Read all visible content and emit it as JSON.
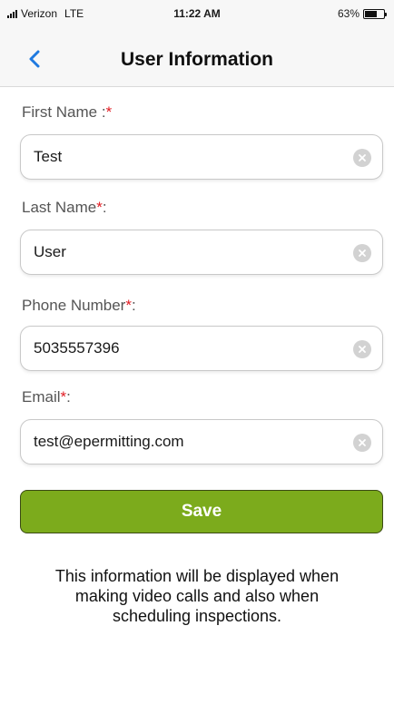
{
  "status_bar": {
    "carrier": "Verizon",
    "network": "LTE",
    "time": "11:22 AM",
    "battery_percent": "63%",
    "battery_level": 0.63
  },
  "nav": {
    "back_icon": "chevron-left-icon",
    "title": "User Information"
  },
  "form": {
    "first_name": {
      "label": "First Name :",
      "required_mark": "*",
      "value": "Test"
    },
    "last_name": {
      "label": "Last Name",
      "required_mark": "*",
      "label_suffix": ":",
      "value": "User"
    },
    "phone": {
      "label": "Phone Number",
      "required_mark": "*",
      "label_suffix": ":",
      "value": "5035557396"
    },
    "email": {
      "label": "Email",
      "required_mark": "*",
      "label_suffix": ":",
      "value": "test@epermitting.com"
    }
  },
  "save_label": "Save",
  "info_text": "This information will be displayed when making video calls and also when scheduling inspections.",
  "colors": {
    "accent_blue": "#1f7ae0",
    "save_green": "#7cab1c",
    "required_red": "#e11b22"
  }
}
